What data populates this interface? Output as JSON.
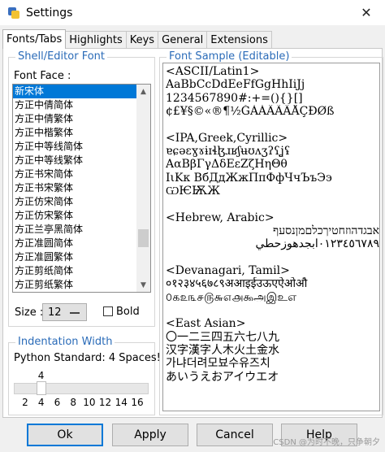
{
  "window": {
    "title": "Settings",
    "close_glyph": "✕"
  },
  "tabs": [
    {
      "label": "Fonts/Tabs",
      "active": true
    },
    {
      "label": "Highlights",
      "active": false
    },
    {
      "label": "Keys",
      "active": false
    },
    {
      "label": "General",
      "active": false
    },
    {
      "label": "Extensions",
      "active": false
    }
  ],
  "shell_font": {
    "legend": "Shell/Editor Font",
    "font_face_label": "Font Face :",
    "fonts": [
      "新宋体",
      "方正中倩简体",
      "方正中倩繁体",
      "方正中楷繁体",
      "方正中等线简体",
      "方正中等线繁体",
      "方正书宋简体",
      "方正书宋繁体",
      "方正仿宋简体",
      "方正仿宋繁体",
      "方正兰亭黑简体",
      "方正准圆简体",
      "方正准圆繁体",
      "方正剪纸简体",
      "方正剪纸繁体"
    ],
    "selected_index": 0,
    "size_label": "Size :",
    "size_value": "12",
    "bold_label": "Bold",
    "bold_checked": false
  },
  "indentation": {
    "legend": "Indentation Width",
    "description": "Python Standard: 4 Spaces!",
    "value": 4,
    "value_text": "4",
    "min": 2,
    "max": 16,
    "ticks": [
      "2",
      "4",
      "6",
      "8",
      "10",
      "12",
      "14",
      "16"
    ]
  },
  "font_sample": {
    "legend": "Font Sample (Editable)",
    "lines": [
      "<ASCII/Latin1>",
      "AaBbCcDdEeFfGgHhIiJj",
      "1234567890#:+=(){}[]",
      "¢£¥§©«®¶½ĞÀÁÂÃÄÅÇÐØß",
      "",
      "<IPA,Greek,Cyrillic>",
      "ɐɕəɛɣɤɨɪɬɮɹʁʃʉʊʌʒʔʕʝʢ",
      "ΑαΒβΓγΔδΕεΖζΗηΘθ",
      "ΙιΚκ ΒбДдЖжПпФфЧчЪъЭэ",
      "ѠѤѬЖ",
      "",
      "<Hebrew, Arabic>",
      "אבגדהוזחטיךכלםמןנסעף",
      "٠١٢٣٤٥٦٧٨٩ابجدهوزحطي",
      "",
      "<Devanagari, Tamil>",
      "०१२३४५६७८९अआइईउऊएऐओऔ",
      "௦௧௨௩௪௫௬௭௮௯அஇஉஎ",
      "",
      "<East Asian>",
      "〇一二三四五六七八九",
      "汉字漢字人木火土金水",
      "가냐더려모뵤수유즈치",
      "あいうえおアイウエオ"
    ]
  },
  "buttons": {
    "ok": "Ok",
    "apply": "Apply",
    "cancel": "Cancel",
    "help": "Help"
  },
  "watermark": "CSDN @为时不晚，只争朝夕"
}
